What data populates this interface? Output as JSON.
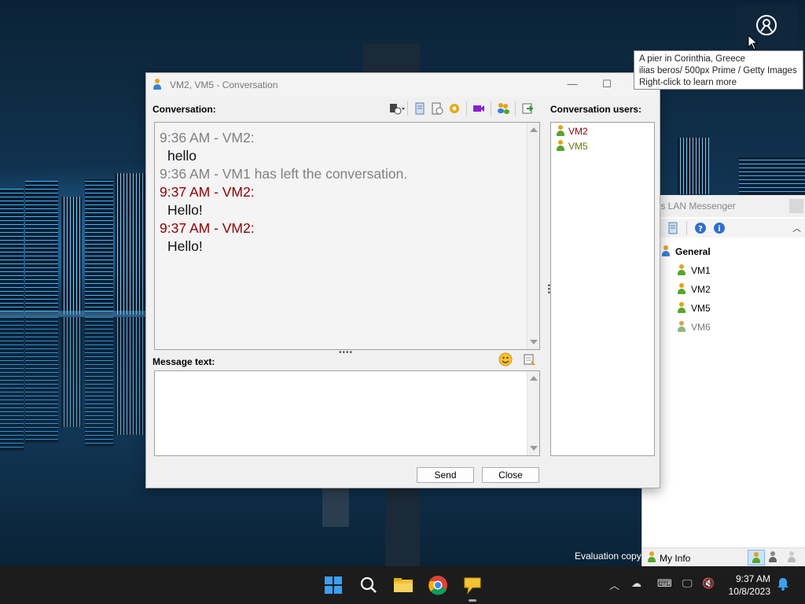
{
  "wallpaper_tooltip": {
    "line1": "A pier in Corinthia, Greece",
    "line2": "ilias beros/ 500px Prime / Getty Images",
    "line3": "Right-click to learn more"
  },
  "conversation_window": {
    "title": "VM2, VM5 - Conversation",
    "conversation_label": "Conversation:",
    "users_label": "Conversation users:",
    "message_label": "Message text:",
    "send_label": "Send",
    "close_label": "Close",
    "history": [
      {
        "header": "9:36 AM - VM2:",
        "style": "gray",
        "text": "hello"
      },
      {
        "header": "9:36 AM - VM1 has left the conversation.",
        "style": "gray",
        "text": ""
      },
      {
        "header": "9:37 AM - VM2:",
        "style": "red",
        "text": "Hello!"
      },
      {
        "header": "9:37 AM - VM2:",
        "style": "red",
        "text": "Hello!"
      }
    ],
    "users": [
      {
        "name": "VM2",
        "color": "#8b0000"
      },
      {
        "name": "VM5",
        "color": "#6b7a00"
      }
    ]
  },
  "messenger_window": {
    "title": "Messenger - LAN Messenger",
    "title_visible": "ftros LAN Messenger",
    "group": "General",
    "contacts": [
      {
        "name": "VM1",
        "color": "#000000"
      },
      {
        "name": "VM2",
        "color": "#000000"
      },
      {
        "name": "VM5",
        "color": "#000000"
      },
      {
        "name": "VM6",
        "color": "#777777"
      }
    ],
    "my_info": "My Info"
  },
  "desktop": {
    "evaluation": "Evaluation copy"
  },
  "taskbar": {
    "time": "9:37 AM",
    "date": "10/8/2023"
  },
  "colors": {
    "accent_blue": "#0078d4",
    "taskbar": "#1c1c1c"
  }
}
